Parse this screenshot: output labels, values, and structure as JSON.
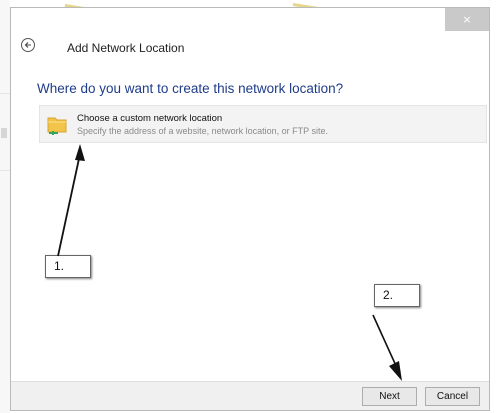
{
  "window": {
    "title": "Add Network Location",
    "close_label": "×"
  },
  "main": {
    "question": "Where do you want to create this network location?",
    "option": {
      "title": "Choose a custom network location",
      "description": "Specify the address of a website, network location, or FTP site.",
      "icon": "folder-network-icon"
    }
  },
  "annotations": [
    {
      "label": "1."
    },
    {
      "label": "2."
    }
  ],
  "footer": {
    "next_label": "Next",
    "cancel_label": "Cancel"
  },
  "colors": {
    "question_text": "#1f3c8b",
    "folder_yellow": "#f2c44a",
    "network_green": "#38a35a"
  }
}
